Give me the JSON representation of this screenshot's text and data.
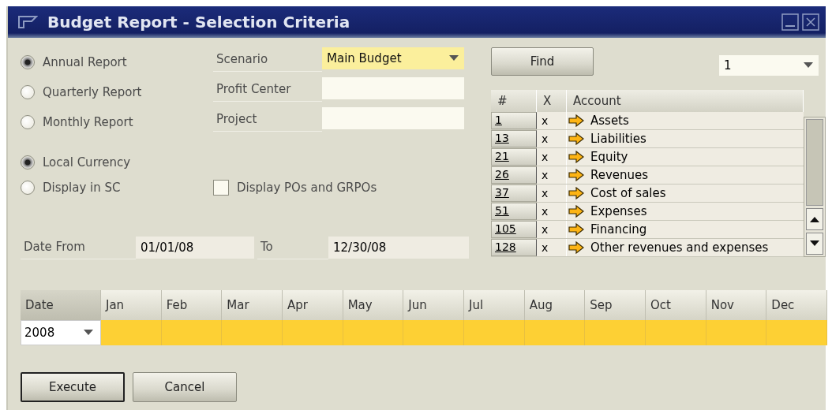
{
  "window": {
    "title": "Budget Report - Selection Criteria"
  },
  "report_type": [
    {
      "label": "Annual Report",
      "selected": true
    },
    {
      "label": "Quarterly Report",
      "selected": false
    },
    {
      "label": "Monthly Report",
      "selected": false
    }
  ],
  "fields": [
    {
      "label": "Scenario",
      "kind": "dropdown",
      "value": "Main Budget",
      "focused": true
    },
    {
      "label": "Profit Center",
      "kind": "text",
      "focused": false
    },
    {
      "label": "Project",
      "kind": "text",
      "focused": false
    }
  ],
  "currency": [
    {
      "label": "Local Currency",
      "selected": true
    },
    {
      "label": "Display in SC",
      "selected": false
    }
  ],
  "display_pos": {
    "label": "Display POs and GRPOs",
    "checked": false
  },
  "date_from": {
    "label": "Date From",
    "value": "01/01/08"
  },
  "date_to": {
    "label": "To",
    "value": "12/30/08"
  },
  "find_button": "Find",
  "page_select": "1",
  "accounts": {
    "columns": [
      "#",
      "X",
      "Account"
    ],
    "rows": [
      {
        "number": "1",
        "x": "x",
        "name": "Assets"
      },
      {
        "number": "13",
        "x": "x",
        "name": "Liabilities"
      },
      {
        "number": "21",
        "x": "x",
        "name": "Equity"
      },
      {
        "number": "26",
        "x": "x",
        "name": "Revenues"
      },
      {
        "number": "37",
        "x": "x",
        "name": "Cost of sales"
      },
      {
        "number": "51",
        "x": "x",
        "name": "Expenses"
      },
      {
        "number": "105",
        "x": "x",
        "name": "Financing"
      },
      {
        "number": "128",
        "x": "x",
        "name": "Other revenues and expenses"
      }
    ]
  },
  "months": {
    "columns": [
      "Date",
      "Jan",
      "Feb",
      "Mar",
      "Apr",
      "May",
      "Jun",
      "Jul",
      "Aug",
      "Sep",
      "Oct",
      "Nov",
      "Dec"
    ],
    "year": "2008"
  },
  "buttons": [
    {
      "label": "Execute",
      "default": true
    },
    {
      "label": "Cancel",
      "default": false
    }
  ]
}
